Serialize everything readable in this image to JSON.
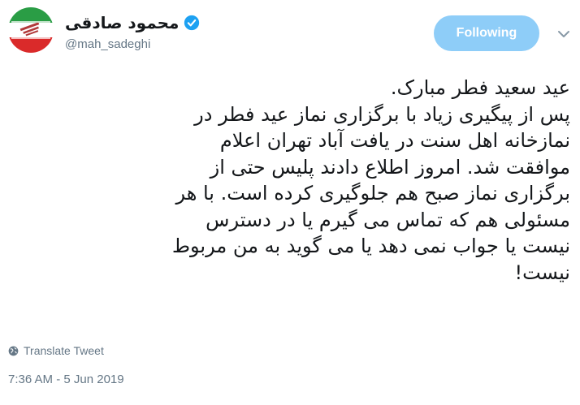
{
  "author": {
    "display_name": "محمود صادقی",
    "handle": "@mah_sadeghi",
    "verified": true,
    "avatar_icon": "iran-flag-avatar-icon"
  },
  "follow_button": {
    "label": "Following"
  },
  "menu_icon": "chevron-down-icon",
  "tweet": {
    "lines": [
      "عید سعید فطر مبارک.",
      "پس از پیگیری زیاد با برگزاری نماز عید فطر در",
      "نمازخانه اهل سنت در یافت آباد تهران اعلام",
      "موافقت شد. امروز اطلاع دادند پلیس حتی از",
      "برگزاری نماز صبح هم جلوگیری کرده است. با هر",
      "مسئولی هم که تماس می گیرم یا در دسترس",
      "نیست یا جواب نمی دهد یا می گوید به من مربوط",
      "نیست!"
    ]
  },
  "translate": {
    "label": "Translate Tweet",
    "icon": "globe-icon"
  },
  "timestamp": "7:36 AM - 5 Jun 2019",
  "colors": {
    "follow_button_bg": "#8ecdf8",
    "verified_blue": "#1da1f2",
    "secondary_text": "#657786",
    "primary_text": "#14171a"
  }
}
